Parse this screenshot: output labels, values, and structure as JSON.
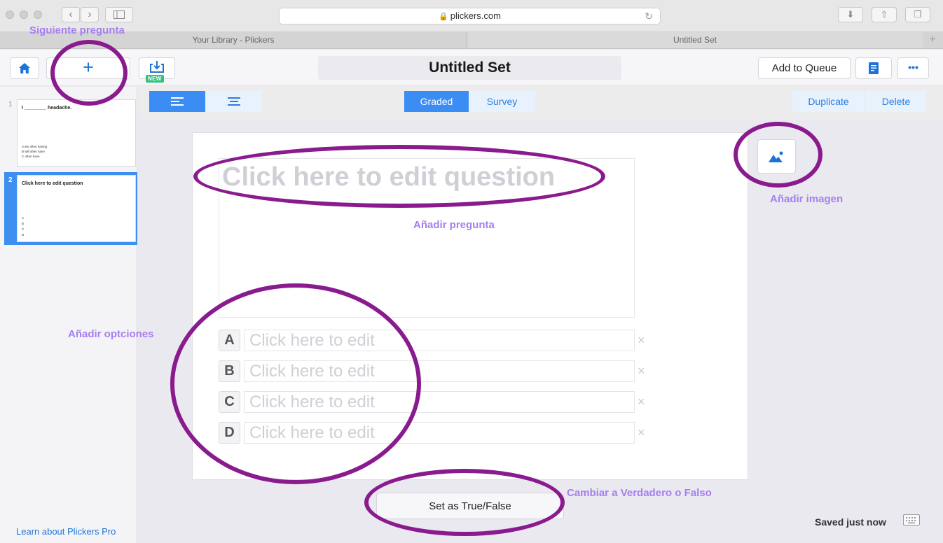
{
  "browser": {
    "url": "plickers.com",
    "tabs": [
      {
        "label": "Your Library - Plickers",
        "active": false
      },
      {
        "label": "Untitled Set",
        "active": true
      }
    ]
  },
  "toolbar": {
    "home_icon": "home-icon",
    "add_label": "+",
    "import_badge": "NEW",
    "title": "Untitled Set",
    "add_to_queue": "Add to Queue",
    "doc_icon": "document-icon",
    "more_label": "•••"
  },
  "subbar": {
    "modes": [
      "Graded",
      "Survey"
    ],
    "duplicate": "Duplicate",
    "delete": "Delete"
  },
  "sidebar": {
    "slides": [
      {
        "number": "1",
        "question": "I ________ headache.",
        "options": [
          "A  am often having",
          "B  will often have",
          "C  often have"
        ]
      },
      {
        "number": "2",
        "question": "Click here to edit question",
        "options": [
          "A",
          "B",
          "C",
          "D"
        ]
      }
    ],
    "learn_link": "Learn about Plickers Pro"
  },
  "editor": {
    "question_placeholder": "Click here to edit question",
    "choices": [
      {
        "letter": "A",
        "placeholder": "Click here to edit"
      },
      {
        "letter": "B",
        "placeholder": "Click here to edit"
      },
      {
        "letter": "C",
        "placeholder": "Click here to edit"
      },
      {
        "letter": "D",
        "placeholder": "Click here to edit"
      }
    ],
    "remove_symbol": "×",
    "true_false_button": "Set as True/False",
    "image_icon": "image-icon"
  },
  "status": {
    "saved": "Saved just now"
  },
  "annotations": {
    "next_question": "Siguiente pregunta",
    "add_question": "Añadir pregunta",
    "add_image": "Añadir imagen",
    "add_options": "Añadir optciones",
    "true_false": "Cambiar a Verdadero o Falso",
    "color": "#8a1b8e",
    "label_color": "#a77ef2"
  }
}
